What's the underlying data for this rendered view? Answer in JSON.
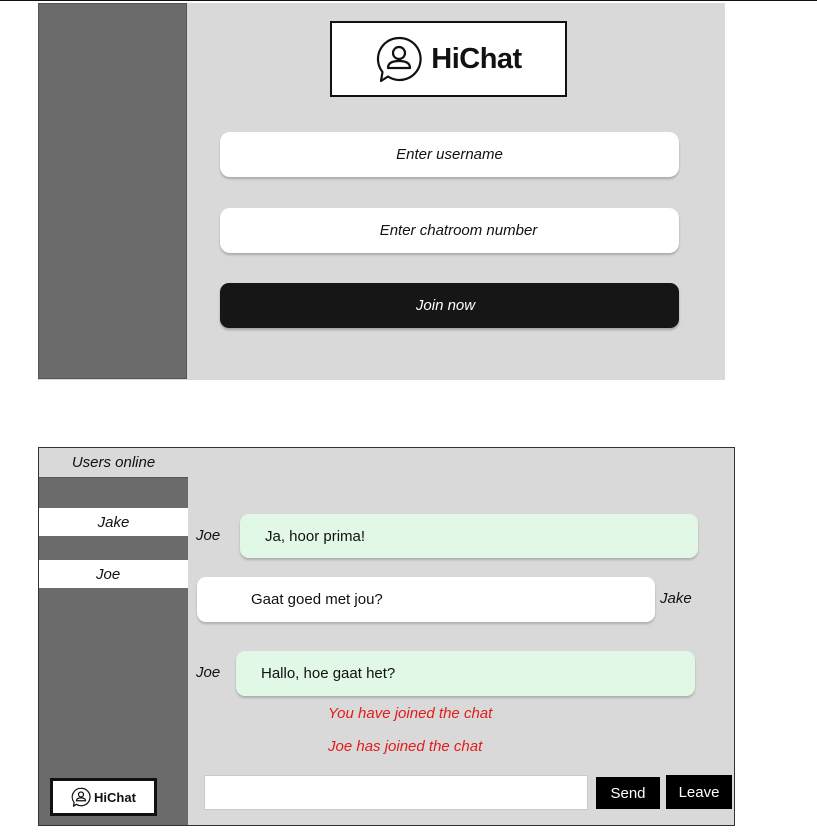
{
  "login": {
    "app_name": "HiChat",
    "username_placeholder": "Enter username",
    "chatroom_placeholder": "Enter chatroom number",
    "join_label": "Join now"
  },
  "chat": {
    "users_header": "Users online",
    "users": [
      "Jake",
      "Joe"
    ],
    "messages": [
      {
        "sender": "Joe",
        "text": "Ja, hoor prima!",
        "side": "left"
      },
      {
        "sender": "Jake",
        "text": "Gaat goed met jou?",
        "side": "right"
      },
      {
        "sender": "Joe",
        "text": "Hallo, hoe gaat het?",
        "side": "left"
      }
    ],
    "system_messages": [
      "You have joined the chat",
      "Joe has joined the chat"
    ],
    "send_label": "Send",
    "leave_label": "Leave",
    "logo_text": "HiChat"
  },
  "colors": {
    "sidebar": "#6b6b6b",
    "panel": "#d9d9d9",
    "own_bubble": "#e2f8e6",
    "system_text": "#e21c1c",
    "button_dark": "#161616"
  },
  "icons": {
    "logo": "chat-user-icon"
  }
}
